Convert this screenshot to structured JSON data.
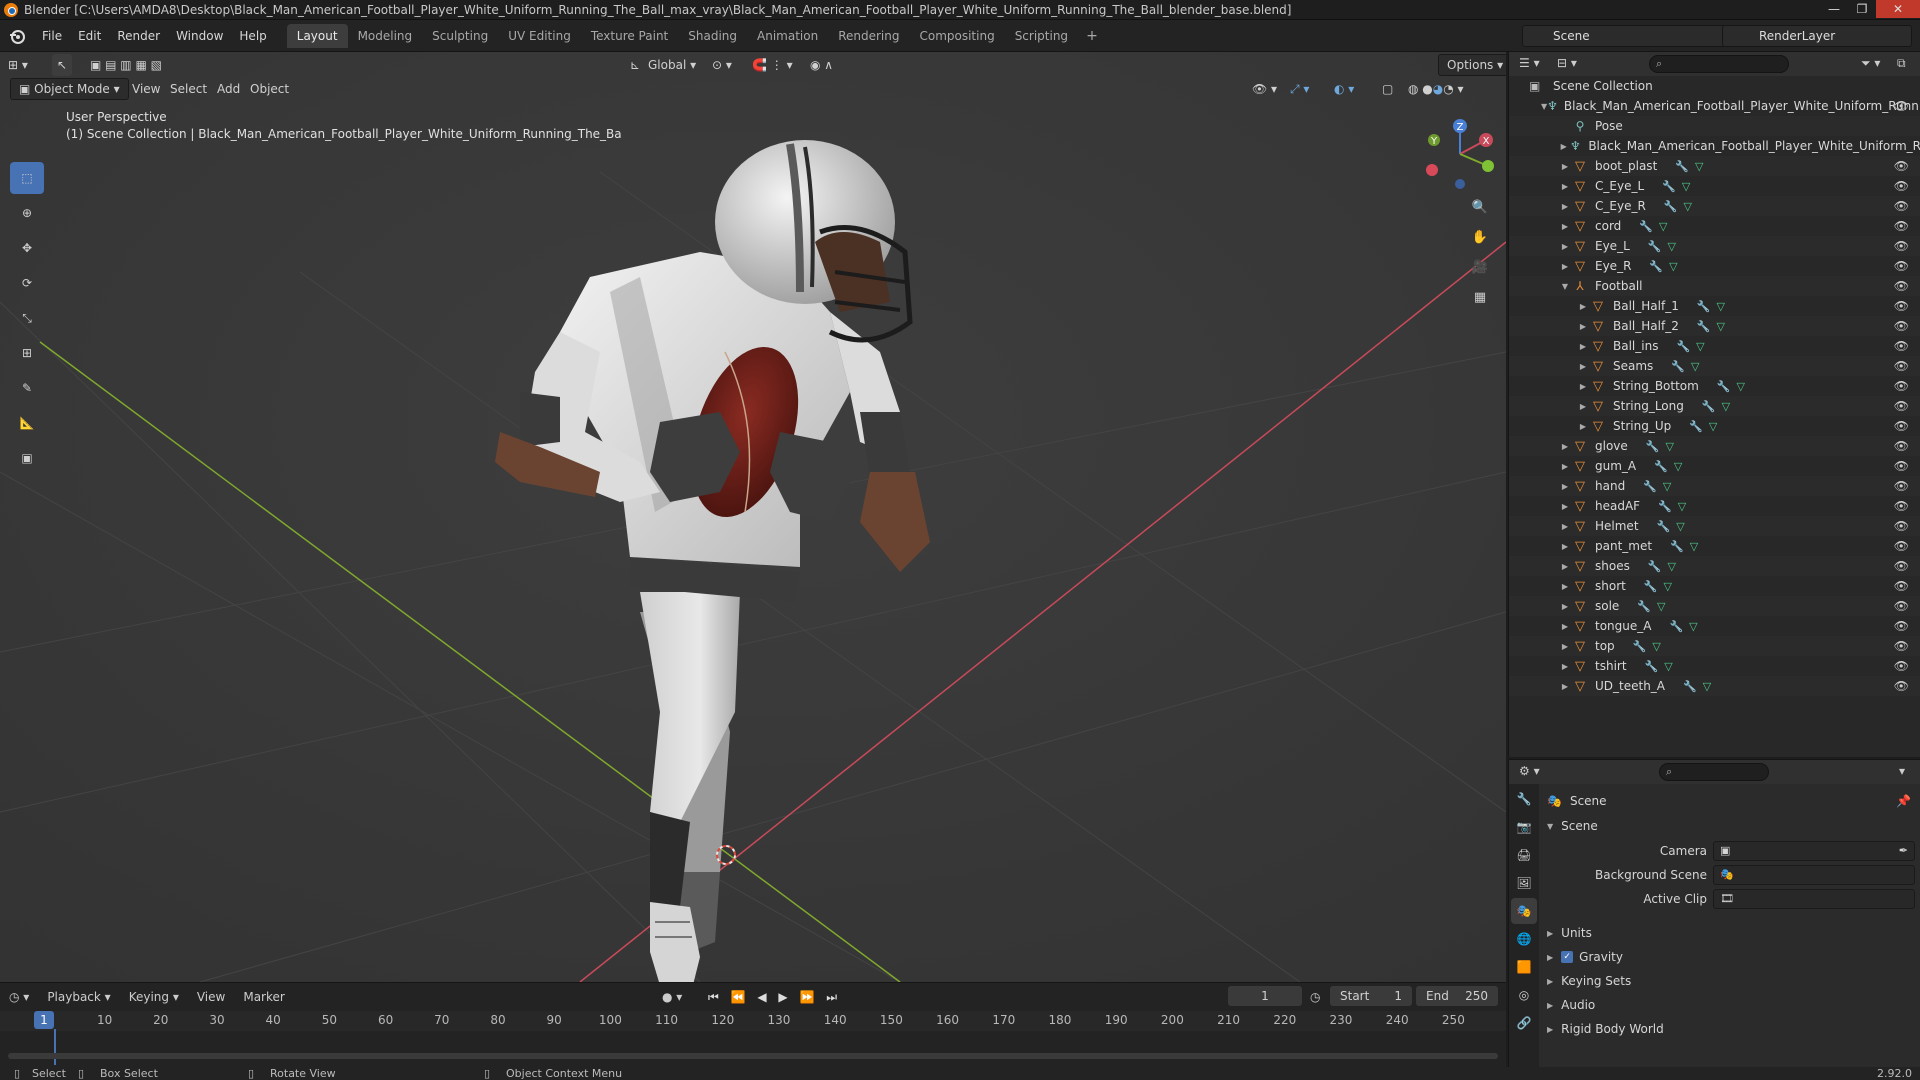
{
  "window": {
    "title": "Blender [C:\\Users\\AMDA8\\Desktop\\Black_Man_American_Football_Player_White_Uniform_Running_The_Ball_max_vray\\Black_Man_American_Football_Player_White_Uniform_Running_The_Ball_blender_base.blend]"
  },
  "menubar": {
    "menus": [
      "File",
      "Edit",
      "Render",
      "Window",
      "Help"
    ],
    "workspaces": [
      "Layout",
      "Modeling",
      "Sculpting",
      "UV Editing",
      "Texture Paint",
      "Shading",
      "Animation",
      "Rendering",
      "Compositing",
      "Scripting"
    ],
    "active_workspace": "Layout",
    "add_symbol": "+",
    "scene": "Scene",
    "view_layer": "RenderLayer"
  },
  "viewport": {
    "mode": "Object Mode",
    "menus": [
      "View",
      "Select",
      "Add",
      "Object"
    ],
    "orientation": "Global",
    "options_label": "Options",
    "perspective_label": "User Perspective",
    "collection_label": "(1) Scene Collection | Black_Man_American_Football_Player_White_Uniform_Running_The_Ba",
    "gizmo": {
      "x": "X",
      "y": "Y",
      "z": "Z"
    }
  },
  "timeline": {
    "menus": [
      "Playback",
      "Keying",
      "View",
      "Marker"
    ],
    "current_frame": "1",
    "start_label": "Start",
    "start": "1",
    "end_label": "End",
    "end": "250",
    "ruler_ticks": [
      "10",
      "20",
      "30",
      "40",
      "50",
      "60",
      "70",
      "80",
      "90",
      "100",
      "110",
      "120",
      "130",
      "140",
      "150",
      "160",
      "170",
      "180",
      "190",
      "200",
      "210",
      "220",
      "230",
      "240",
      "250"
    ],
    "cursor_frame": "1"
  },
  "statusbar": {
    "select": "Select",
    "box_select": "Box Select",
    "rotate_view": "Rotate View",
    "context_menu": "Object Context Menu",
    "version": "2.92.0"
  },
  "outliner": {
    "root": "Scene Collection",
    "items": [
      {
        "label": "Black_Man_American_Football_Player_White_Uniform_Runni",
        "type": "armature-root",
        "level": 1,
        "mods": false
      },
      {
        "label": "Pose",
        "type": "pose",
        "level": 2,
        "mods": false
      },
      {
        "label": "Black_Man_American_Football_Player_White_Uniform_R",
        "type": "armature",
        "level": 2,
        "mods": false
      },
      {
        "label": "boot_plast",
        "type": "mesh",
        "level": 2,
        "mods": true
      },
      {
        "label": "C_Eye_L",
        "type": "mesh",
        "level": 2,
        "mods": true
      },
      {
        "label": "C_Eye_R",
        "type": "mesh",
        "level": 2,
        "mods": true
      },
      {
        "label": "cord",
        "type": "mesh",
        "level": 2,
        "mods": true
      },
      {
        "label": "Eye_L",
        "type": "mesh",
        "level": 2,
        "mods": true
      },
      {
        "label": "Eye_R",
        "type": "mesh",
        "level": 2,
        "mods": true
      },
      {
        "label": "Football",
        "type": "empty",
        "level": 2,
        "mods": false
      },
      {
        "label": "Ball_Half_1",
        "type": "mesh",
        "level": 3,
        "mods": true
      },
      {
        "label": "Ball_Half_2",
        "type": "mesh",
        "level": 3,
        "mods": true
      },
      {
        "label": "Ball_ins",
        "type": "mesh",
        "level": 3,
        "mods": true
      },
      {
        "label": "Seams",
        "type": "mesh",
        "level": 3,
        "mods": true
      },
      {
        "label": "String_Bottom",
        "type": "mesh",
        "level": 3,
        "mods": true
      },
      {
        "label": "String_Long",
        "type": "mesh",
        "level": 3,
        "mods": true
      },
      {
        "label": "String_Up",
        "type": "mesh",
        "level": 3,
        "mods": true
      },
      {
        "label": "glove",
        "type": "mesh",
        "level": 2,
        "mods": true
      },
      {
        "label": "gum_A",
        "type": "mesh",
        "level": 2,
        "mods": true
      },
      {
        "label": "hand",
        "type": "mesh",
        "level": 2,
        "mods": true
      },
      {
        "label": "headAF",
        "type": "mesh",
        "level": 2,
        "mods": true
      },
      {
        "label": "Helmet",
        "type": "mesh",
        "level": 2,
        "mods": true
      },
      {
        "label": "pant_met",
        "type": "mesh",
        "level": 2,
        "mods": true
      },
      {
        "label": "shoes",
        "type": "mesh",
        "level": 2,
        "mods": true
      },
      {
        "label": "short",
        "type": "mesh",
        "level": 2,
        "mods": true
      },
      {
        "label": "sole",
        "type": "mesh",
        "level": 2,
        "mods": true
      },
      {
        "label": "tongue_A",
        "type": "mesh",
        "level": 2,
        "mods": true
      },
      {
        "label": "top",
        "type": "mesh",
        "level": 2,
        "mods": true
      },
      {
        "label": "tshirt",
        "type": "mesh",
        "level": 2,
        "mods": true
      },
      {
        "label": "UD_teeth_A",
        "type": "mesh",
        "level": 2,
        "mods": true
      }
    ]
  },
  "properties": {
    "context": "Scene",
    "panel": "Scene",
    "fields": [
      {
        "label": "Camera"
      },
      {
        "label": "Background Scene"
      },
      {
        "label": "Active Clip"
      }
    ],
    "sections": [
      "Units",
      "Gravity",
      "Keying Sets",
      "Audio",
      "Rigid Body World"
    ],
    "gravity_checked": true
  },
  "colors": {
    "accent": "#4772b3",
    "viewport_bg": "#393939",
    "axis_x": "#c94a5a",
    "axis_y": "#7fa82d"
  }
}
